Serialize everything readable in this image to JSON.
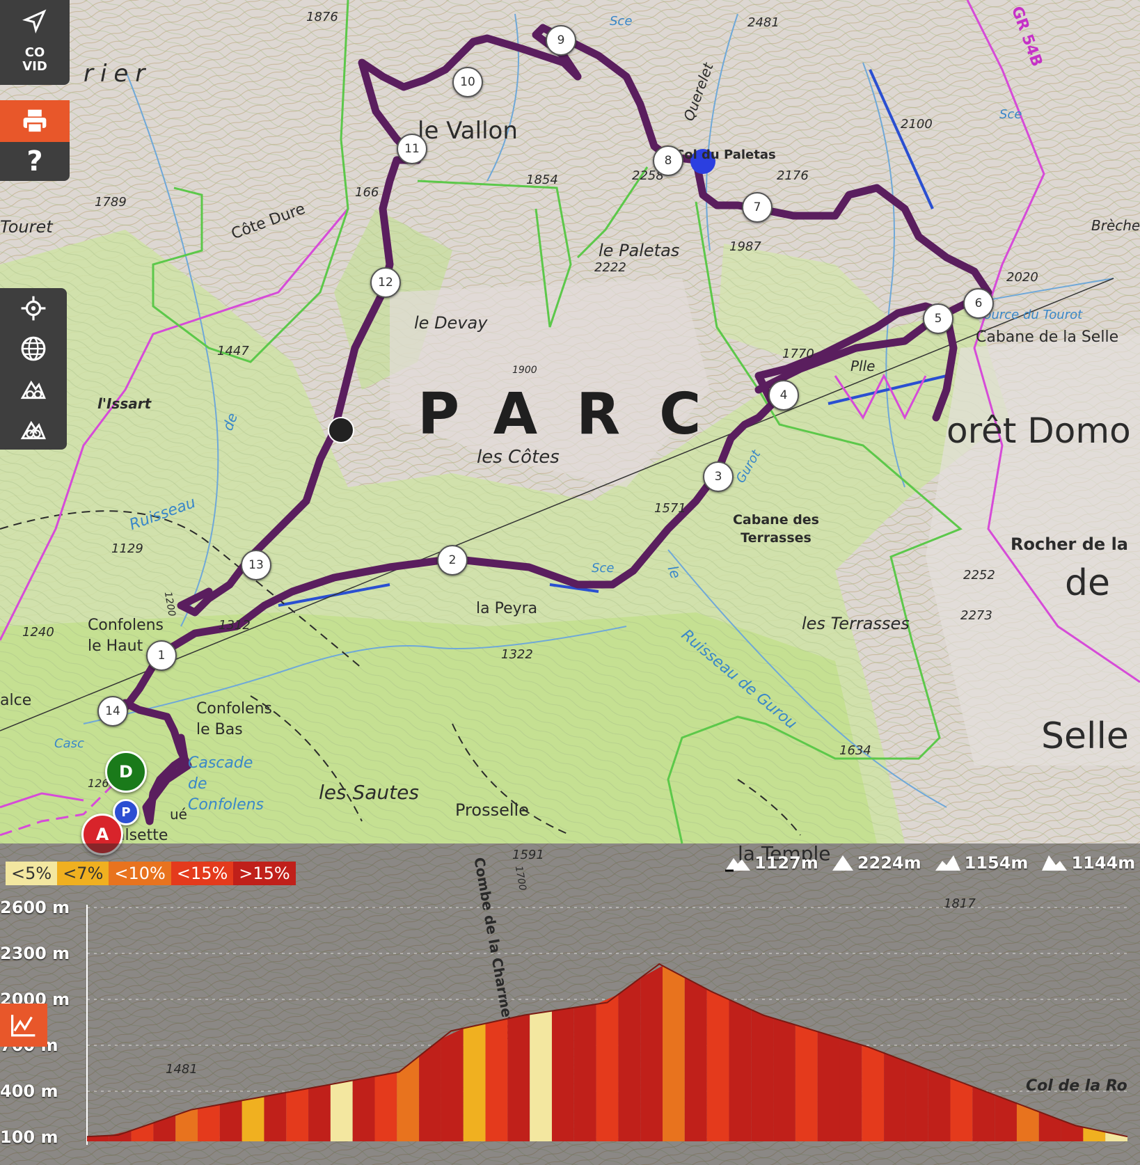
{
  "toolbar": {
    "covid_label": "CO VID",
    "help_label": "?"
  },
  "map": {
    "park_label": "PARC",
    "labels": {
      "vallon": "le Vallon",
      "cote_dure": "Côte Dure",
      "touret": "Touret",
      "rier": "rier",
      "devay": "le Devay",
      "paletas": "le Paletas",
      "col_paletas": "Col du Paletas",
      "querelet": "Querelet",
      "les_cotes": "les Côtes",
      "issart": "l'Issart",
      "confolens_haut": "Confolens le Haut",
      "confolens_bas": "Confolens le Bas",
      "cascade": "Cascade de Confolens",
      "la_peyra": "la Peyra",
      "les_sautes": "les Sautes",
      "prosselle": "Prosselle",
      "combe": "Combe de la Charmette",
      "cabane_terrasses": "Cabane des Terrasses",
      "les_terrasses": "les Terrasses",
      "cabane_selle": "Cabane de la Selle",
      "source_tourot": "Source du Tourot",
      "foret": "orêt Domo",
      "rocher": "Rocher de la",
      "de": "de",
      "selle": "Selle",
      "breche": "Brèche",
      "gr54b": "GR 54B",
      "ruisseau": "Ruisseau",
      "ruisseau_gurou": "Ruisseau de Gurou",
      "le_temple": "la Temple",
      "col_de_la_ro": "Col de la Ro",
      "plle": "Plle",
      "alsette": "alsette",
      "alce": "alce",
      "sce": "Sce",
      "gurot": "Gurot",
      "ue": "ué",
      "cascade_short": "Casc",
      "de_small": "de",
      "e_small": "e",
      "le_small": "le"
    },
    "elevations": [
      "1876",
      "2481",
      "1789",
      "1854",
      "2258",
      "2176",
      "2222",
      "1987",
      "2100",
      "2020",
      "1447",
      "1770",
      "1900",
      "1571",
      "1129",
      "1240",
      "1312",
      "1322",
      "2252",
      "2273",
      "1634",
      "1591",
      "1817",
      "1481",
      "1700",
      "1200",
      "166",
      "126"
    ],
    "waypoints": [
      "1",
      "2",
      "3",
      "4",
      "5",
      "6",
      "7",
      "8",
      "9",
      "10",
      "11",
      "12",
      "13",
      "14"
    ],
    "pins": {
      "start": "D",
      "end": "A",
      "parking": "P"
    }
  },
  "profile": {
    "legend": [
      {
        "label": "<5%",
        "color": "#f3e7a0"
      },
      {
        "label": "<7%",
        "color": "#f0b020"
      },
      {
        "label": "<10%",
        "color": "#e8731e"
      },
      {
        "label": "<15%",
        "color": "#e43a1c"
      },
      {
        "label": ">15%",
        "color": "#c0201a"
      }
    ],
    "stats": {
      "min_altitude": "1127m",
      "max_altitude": "2224m",
      "elevation_gain": "1154m",
      "elevation_loss": "1144m"
    },
    "y_labels": [
      "2600 m",
      "2300 m",
      "2000 m",
      "700 m",
      "400 m",
      "100 m"
    ]
  },
  "chart_data": {
    "type": "area",
    "title": "",
    "xlabel": "",
    "ylabel": "",
    "ylim": [
      1100,
      2600
    ],
    "y_ticks": [
      "100 m",
      "400 m",
      "700 m",
      "2000 m",
      "2300 m",
      "2600 m"
    ],
    "x": [
      0,
      0.03,
      0.1,
      0.2,
      0.3,
      0.35,
      0.42,
      0.5,
      0.55,
      0.6,
      0.65,
      0.75,
      0.85,
      0.95,
      1.0
    ],
    "values": [
      1130,
      1140,
      1300,
      1420,
      1540,
      1800,
      1900,
      1980,
      2224,
      2050,
      1900,
      1700,
      1450,
      1200,
      1130
    ],
    "series": [
      {
        "values": [
          1130,
          1140,
          1300,
          1420,
          1540,
          1800,
          1900,
          1980,
          2224,
          2050,
          1900,
          1700,
          1450,
          1200,
          1130
        ]
      }
    ]
  }
}
